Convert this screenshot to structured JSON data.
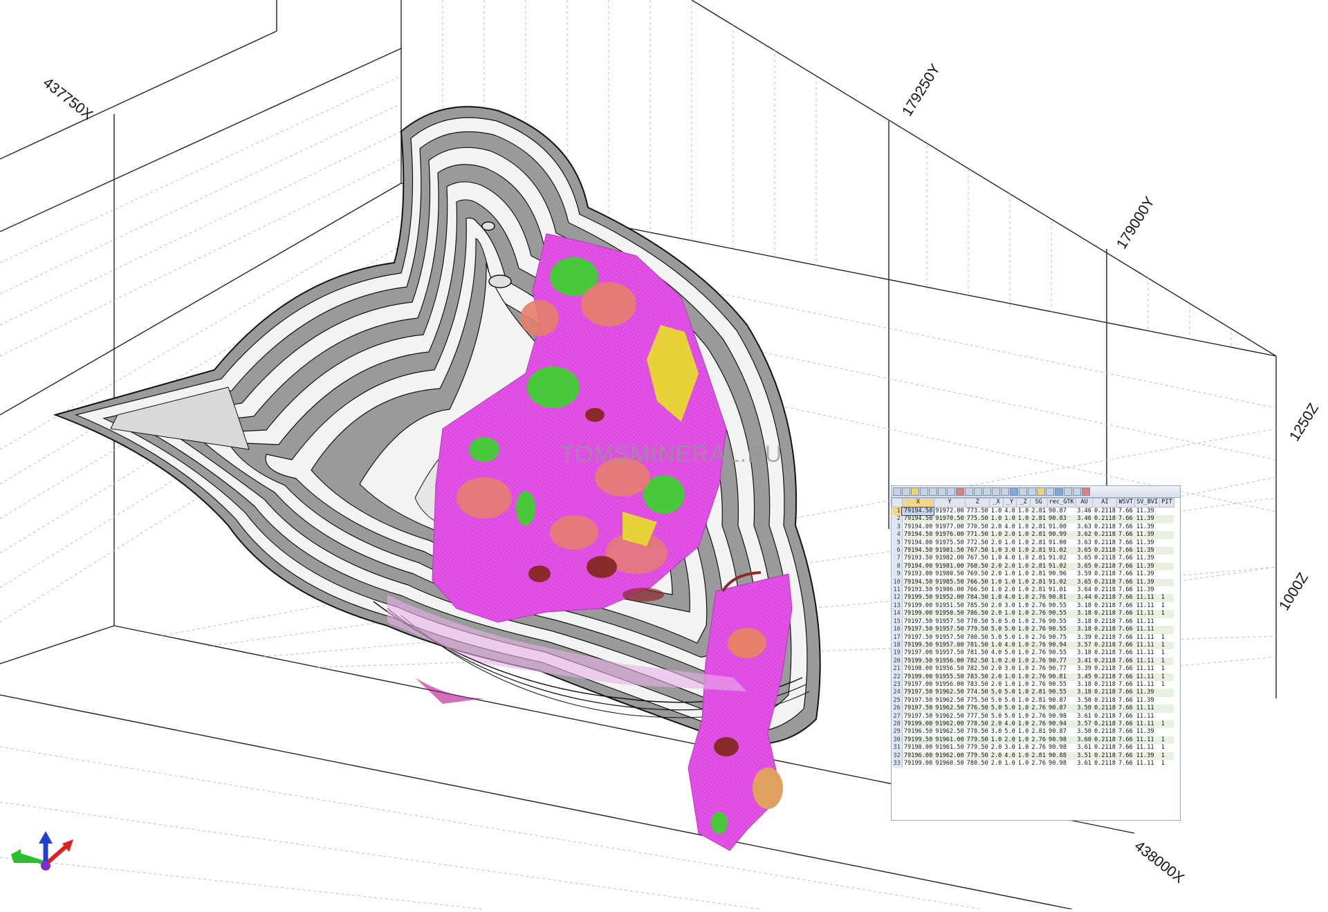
{
  "axis_labels": {
    "x_top": "437750X",
    "x_bottom": "438000X",
    "y_top": "179250Y",
    "y_mid": "179000Y",
    "z_high": "1250Z",
    "z_low": "1000Z"
  },
  "watermark": "TOMSMINERAL.RU",
  "grid": {
    "columns": [
      "X",
      "Y",
      "Z",
      "_X",
      "_Y",
      "_Z",
      "SG",
      "rec_GTK",
      "AU",
      "AI",
      "WSVT",
      "SV_BVI",
      "PIT"
    ],
    "rows": [
      [
        "1",
        "79194.50",
        "91972.00",
        "773.50",
        "1.0",
        "4.0",
        "1.0",
        "2.81",
        "90.87",
        "3.46",
        "0.2118",
        "7.66",
        "11.39",
        ""
      ],
      [
        "2",
        "79194.50",
        "91970.50",
        "775.50",
        "1.0",
        "1.0",
        "1.0",
        "2.81",
        "90.83",
        "3.46",
        "0.2118",
        "7.66",
        "11.39",
        ""
      ],
      [
        "3",
        "79194.00",
        "91977.00",
        "770.50",
        "2.0",
        "4.0",
        "1.0",
        "2.81",
        "91.00",
        "3.63",
        "0.2118",
        "7.66",
        "11.39",
        ""
      ],
      [
        "4",
        "79194.50",
        "91976.00",
        "771.50",
        "1.0",
        "2.0",
        "1.0",
        "2.81",
        "90.99",
        "3.62",
        "0.2118",
        "7.66",
        "11.39",
        ""
      ],
      [
        "5",
        "79194.00",
        "91975.50",
        "772.50",
        "2.0",
        "1.0",
        "1.0",
        "2.81",
        "91.00",
        "3.63",
        "0.2118",
        "7.66",
        "11.39",
        ""
      ],
      [
        "6",
        "79194.50",
        "91981.50",
        "767.50",
        "1.0",
        "3.0",
        "1.0",
        "2.81",
        "91.02",
        "3.65",
        "0.2118",
        "7.66",
        "11.39",
        ""
      ],
      [
        "7",
        "79193.50",
        "91982.00",
        "767.50",
        "1.0",
        "4.0",
        "1.0",
        "2.81",
        "91.02",
        "3.65",
        "0.2118",
        "7.66",
        "11.39",
        ""
      ],
      [
        "8",
        "79194.00",
        "91981.00",
        "768.50",
        "2.0",
        "2.0",
        "1.0",
        "2.81",
        "91.02",
        "3.65",
        "0.2118",
        "7.66",
        "11.39",
        ""
      ],
      [
        "9",
        "79193.00",
        "91980.50",
        "769.50",
        "2.0",
        "1.0",
        "1.0",
        "2.81",
        "90.96",
        "3.59",
        "0.2118",
        "7.66",
        "11.39",
        ""
      ],
      [
        "10",
        "79194.50",
        "91985.50",
        "766.50",
        "1.0",
        "1.0",
        "1.0",
        "2.81",
        "91.02",
        "3.65",
        "0.2118",
        "7.66",
        "11.39",
        ""
      ],
      [
        "11",
        "79193.50",
        "91986.00",
        "766.50",
        "1.0",
        "2.0",
        "1.0",
        "2.81",
        "91.01",
        "3.64",
        "0.2118",
        "7.66",
        "11.39",
        ""
      ],
      [
        "12",
        "79199.50",
        "91952.00",
        "784.50",
        "1.0",
        "4.0",
        "1.0",
        "2.76",
        "90.81",
        "3.44",
        "0.2118",
        "7.66",
        "11.11",
        "1"
      ],
      [
        "13",
        "79199.00",
        "91951.50",
        "785.50",
        "2.0",
        "3.0",
        "1.0",
        "2.76",
        "90.55",
        "3.18",
        "0.2118",
        "7.66",
        "11.11",
        "1"
      ],
      [
        "14",
        "79199.00",
        "91950.50",
        "786.50",
        "2.0",
        "1.0",
        "1.0",
        "2.76",
        "90.55",
        "3.18",
        "0.2118",
        "7.66",
        "11.11",
        "1"
      ],
      [
        "15",
        "79197.50",
        "91957.50",
        "778.50",
        "5.0",
        "5.0",
        "1.0",
        "2.76",
        "90.55",
        "3.18",
        "0.2118",
        "7.66",
        "11.11",
        ""
      ],
      [
        "16",
        "79197.50",
        "91957.50",
        "779.50",
        "5.0",
        "5.0",
        "1.0",
        "2.76",
        "90.55",
        "3.18",
        "0.2118",
        "7.66",
        "11.11",
        ""
      ],
      [
        "17",
        "79197.50",
        "91957.50",
        "780.50",
        "5.0",
        "5.0",
        "1.0",
        "2.76",
        "90.75",
        "3.39",
        "0.2118",
        "7.66",
        "11.11",
        "1"
      ],
      [
        "18",
        "79199.50",
        "91957.00",
        "781.50",
        "1.0",
        "4.0",
        "1.0",
        "2.76",
        "90.94",
        "3.57",
        "0.2118",
        "7.66",
        "11.11",
        "1"
      ],
      [
        "19",
        "79197.00",
        "91957.50",
        "781.50",
        "4.0",
        "5.0",
        "1.0",
        "2.76",
        "90.55",
        "3.18",
        "0.2118",
        "7.66",
        "11.11",
        "1"
      ],
      [
        "20",
        "79199.50",
        "91956.00",
        "782.50",
        "1.0",
        "2.0",
        "1.0",
        "2.76",
        "90.77",
        "3.41",
        "0.2118",
        "7.66",
        "11.11",
        "1"
      ],
      [
        "21",
        "79198.00",
        "91956.50",
        "782.50",
        "2.0",
        "3.0",
        "1.0",
        "2.76",
        "90.77",
        "3.39",
        "0.2118",
        "7.66",
        "11.11",
        "1"
      ],
      [
        "22",
        "79199.00",
        "91955.50",
        "783.50",
        "2.0",
        "1.0",
        "1.0",
        "2.76",
        "90.81",
        "3.45",
        "0.2118",
        "7.66",
        "11.11",
        "1"
      ],
      [
        "23",
        "79197.00",
        "91956.00",
        "783.50",
        "2.0",
        "1.0",
        "1.0",
        "2.76",
        "90.55",
        "3.18",
        "0.2118",
        "7.66",
        "11.11",
        "1"
      ],
      [
        "24",
        "79197.50",
        "91962.50",
        "774.50",
        "5.0",
        "5.0",
        "1.0",
        "2.81",
        "90.55",
        "3.18",
        "0.2118",
        "7.66",
        "11.39",
        ""
      ],
      [
        "25",
        "79197.50",
        "91962.50",
        "775.50",
        "5.0",
        "5.0",
        "1.0",
        "2.81",
        "90.87",
        "3.50",
        "0.2118",
        "7.66",
        "11.39",
        ""
      ],
      [
        "26",
        "79197.50",
        "91962.50",
        "776.50",
        "5.0",
        "5.0",
        "1.0",
        "2.76",
        "90.87",
        "3.50",
        "0.2118",
        "7.66",
        "11.11",
        ""
      ],
      [
        "27",
        "79197.50",
        "91962.50",
        "777.50",
        "5.0",
        "5.0",
        "1.0",
        "2.76",
        "90.98",
        "3.61",
        "0.2118",
        "7.66",
        "11.11",
        ""
      ],
      [
        "28",
        "79199.00",
        "91962.00",
        "778.50",
        "2.0",
        "4.0",
        "1.0",
        "2.76",
        "90.94",
        "3.57",
        "0.2118",
        "7.66",
        "11.11",
        "1"
      ],
      [
        "29",
        "79196.50",
        "91962.50",
        "778.50",
        "3.0",
        "5.0",
        "1.0",
        "2.81",
        "90.87",
        "3.50",
        "0.2118",
        "7.66",
        "11.39",
        ""
      ],
      [
        "30",
        "79199.50",
        "91961.00",
        "779.50",
        "1.0",
        "2.0",
        "1.0",
        "2.76",
        "90.98",
        "3.60",
        "0.2118",
        "7.66",
        "11.11",
        "1"
      ],
      [
        "31",
        "79198.00",
        "91961.50",
        "779.50",
        "2.0",
        "3.0",
        "1.0",
        "2.76",
        "90.98",
        "3.61",
        "0.2118",
        "7.66",
        "11.11",
        "1"
      ],
      [
        "32",
        "79196.00",
        "91962.00",
        "779.50",
        "2.0",
        "4.0",
        "1.0",
        "2.81",
        "90.88",
        "3.51",
        "0.2118",
        "7.66",
        "11.39",
        "1"
      ],
      [
        "33",
        "79199.00",
        "91960.50",
        "780.50",
        "2.0",
        "1.0",
        "1.0",
        "2.76",
        "90.98",
        "3.61",
        "0.2118",
        "7.66",
        "11.11",
        "1"
      ]
    ]
  },
  "colors": {
    "ore_magenta": "#e64ee8",
    "ore_green": "#48c83a",
    "ore_salmon": "#e6806a",
    "ore_yellow": "#e8d23a",
    "ore_brown": "#8a2a2a",
    "pit_bench": "#9c9c9c",
    "pit_face": "#f2f2f2"
  },
  "icons": [
    "orientation-triad-icon"
  ]
}
